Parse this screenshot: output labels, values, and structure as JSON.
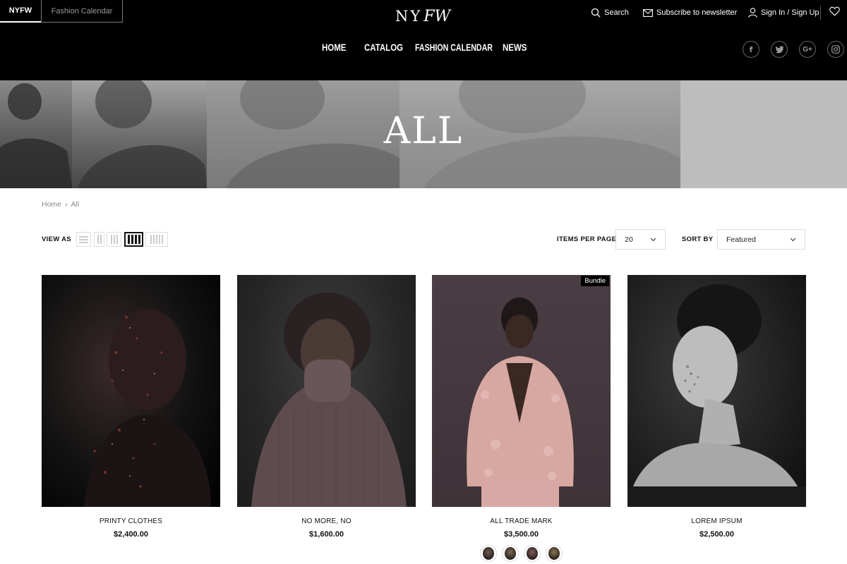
{
  "top_tabs": [
    {
      "label": "NYFW",
      "active": true
    },
    {
      "label": "Fashion Calendar",
      "active": false
    }
  ],
  "logo": {
    "text_ny": "NY",
    "text_fw": "FW"
  },
  "utility": {
    "search": "Search",
    "subscribe": "Subscribe to newsletter",
    "signin": "Sign In / Sign Up"
  },
  "nav": [
    {
      "label": "HOME"
    },
    {
      "label": "CATALOG"
    },
    {
      "label": "FASHION CALENDAR"
    },
    {
      "label": "NEWS"
    }
  ],
  "social": [
    {
      "icon": "facebook-icon",
      "glyph": "f"
    },
    {
      "icon": "twitter-icon",
      "glyph": "t"
    },
    {
      "icon": "google-plus-icon",
      "glyph": "G+"
    },
    {
      "icon": "instagram-icon",
      "glyph": "ig"
    }
  ],
  "banner": {
    "title": "ALL"
  },
  "breadcrumb": {
    "home": "Home",
    "separator": "›",
    "current": "All"
  },
  "toolbar": {
    "view_as": "VIEW AS",
    "items_per_page_label": "ITEMS PER PAGE",
    "items_per_page_value": "20",
    "sort_label": "SORT BY",
    "sort_value": "Featured"
  },
  "products": [
    {
      "name": "PRINTY CLOTHES",
      "price": "$2,400.00",
      "badge": ""
    },
    {
      "name": "NO MORE, NO",
      "price": "$1,600.00",
      "badge": ""
    },
    {
      "name": "ALL TRADE MARK",
      "price": "$3,500.00",
      "badge": "Bundle"
    },
    {
      "name": "LOREM IPSUM",
      "price": "$2,500.00",
      "badge": ""
    }
  ],
  "colors": {
    "header_bg": "#000000",
    "accent": "#111111",
    "banner_bg": "#b9b9b9"
  }
}
